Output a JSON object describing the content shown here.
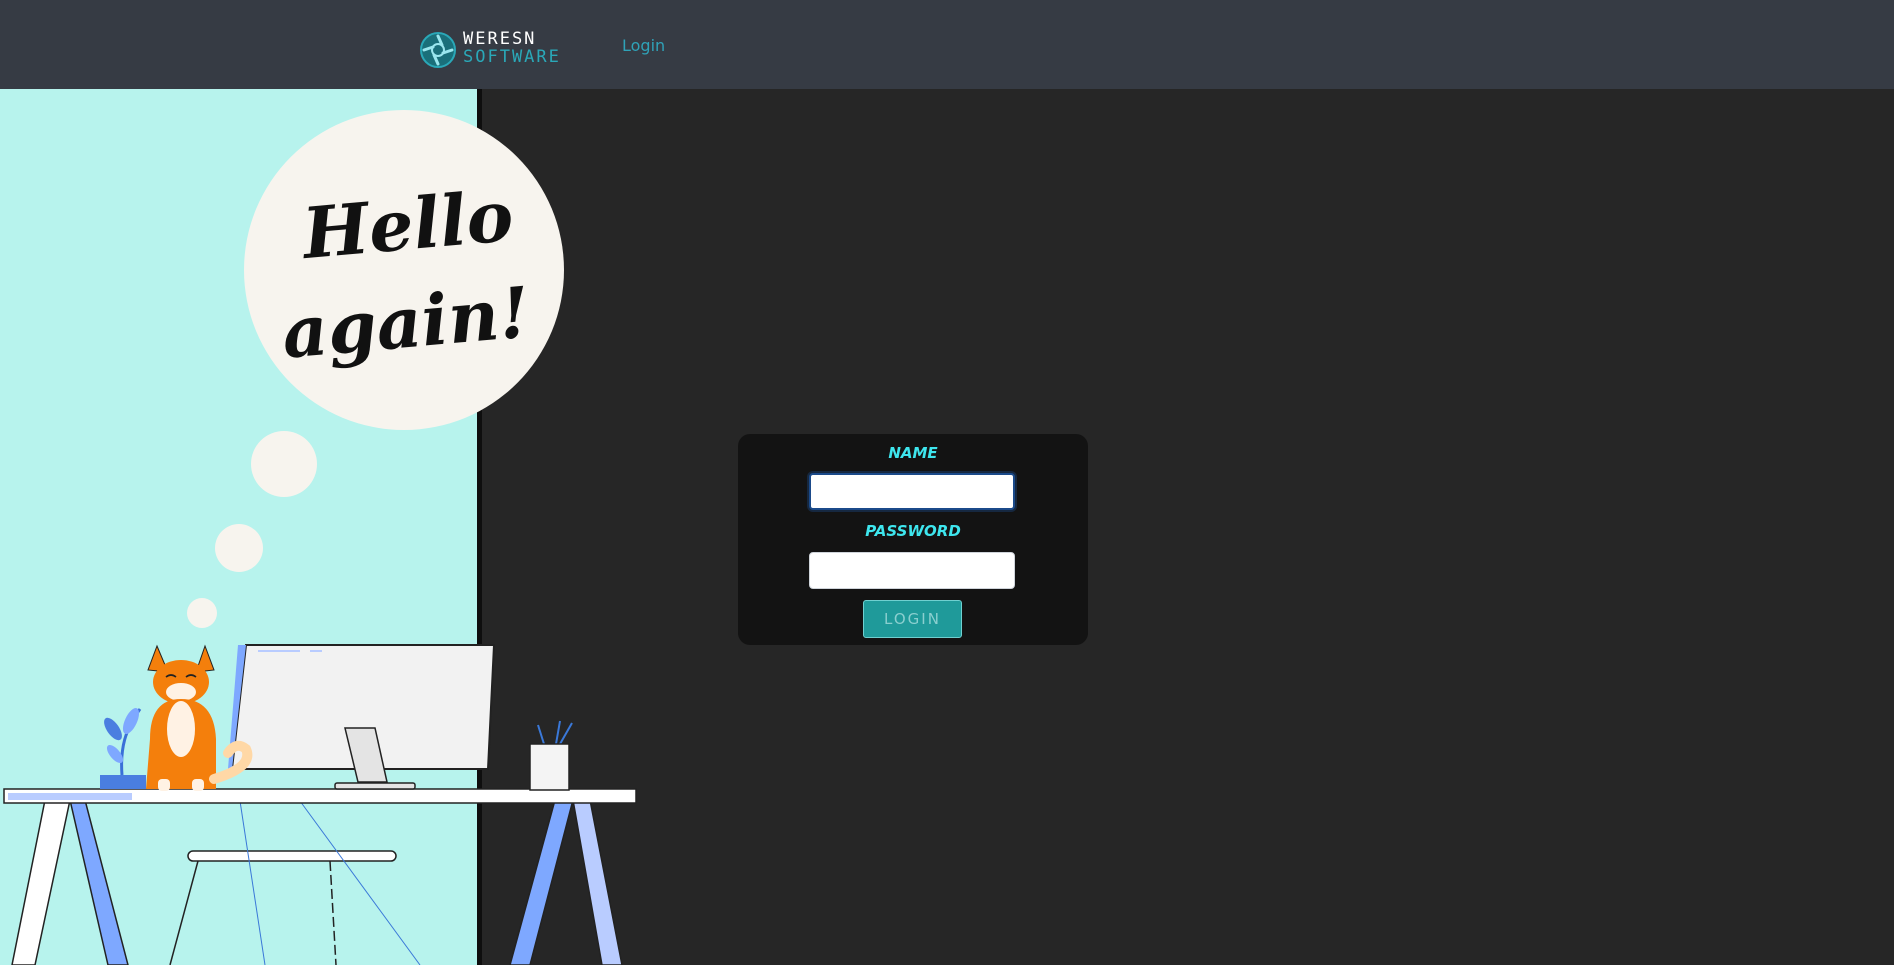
{
  "navbar": {
    "brand": {
      "line1": "WERESN",
      "line2": "SOFTWARE"
    },
    "login_link": "Login"
  },
  "illustration": {
    "speech_line1": "Hello",
    "speech_line2": "again!"
  },
  "form": {
    "name_label": "NAME",
    "name_value": "",
    "password_label": "PASSWORD",
    "password_value": "",
    "submit_label": "LOGIN"
  },
  "colors": {
    "navbar_bg": "#363b44",
    "page_bg": "#262626",
    "card_bg": "#131313",
    "accent_cyan": "#3ee6ee",
    "button_teal": "#1f9a9a",
    "illustration_bg": "#b7f3ed"
  }
}
